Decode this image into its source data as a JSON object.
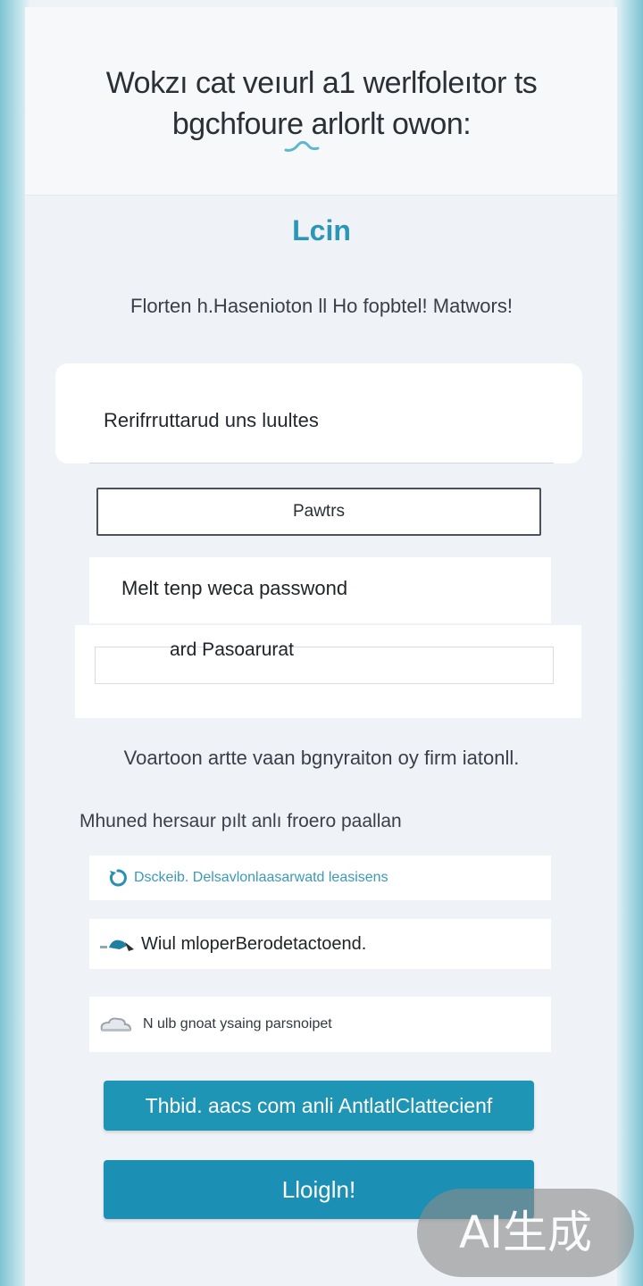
{
  "header": {
    "title_line1": "Wokzı cat veıurl a1  werlfoleıtor ts",
    "title_line2": "bgchfoure arlorlt owon:"
  },
  "login": {
    "heading": "Lcin",
    "subtitle": "Florten h.Hasenioton ll Ho fopbtel! Matwors!"
  },
  "form": {
    "panel_label": "Rerifrruttarud uns luultes",
    "password_label": "Pawtrs",
    "temp_password_label": "Melt tenp weca passwond",
    "confirm_label": "ard Pasoarurat"
  },
  "notice": "Voartoon artte vaan bgnyraiton oy firm iatonll.",
  "options": {
    "section_label": "Mhuned hersaur pılt anlı froero paallan",
    "items": [
      {
        "label": "Dsckeib. Delsavlonlaasarwatd leasisens",
        "icon": "refresh-icon"
      },
      {
        "label": "Wiul mloperBerodetactoend.",
        "icon": "hand-icon"
      },
      {
        "label": "N ulb gnoat ysaing parsnoipet",
        "icon": "cloud-icon"
      }
    ]
  },
  "actions": {
    "secondary_label": "Thbid. aacs com anli AntlatlClattecienf",
    "login_label": "Lloigln!"
  },
  "watermark": "AI生成",
  "colors": {
    "accent": "#1b8fb4",
    "heading": "#2a97b7"
  }
}
